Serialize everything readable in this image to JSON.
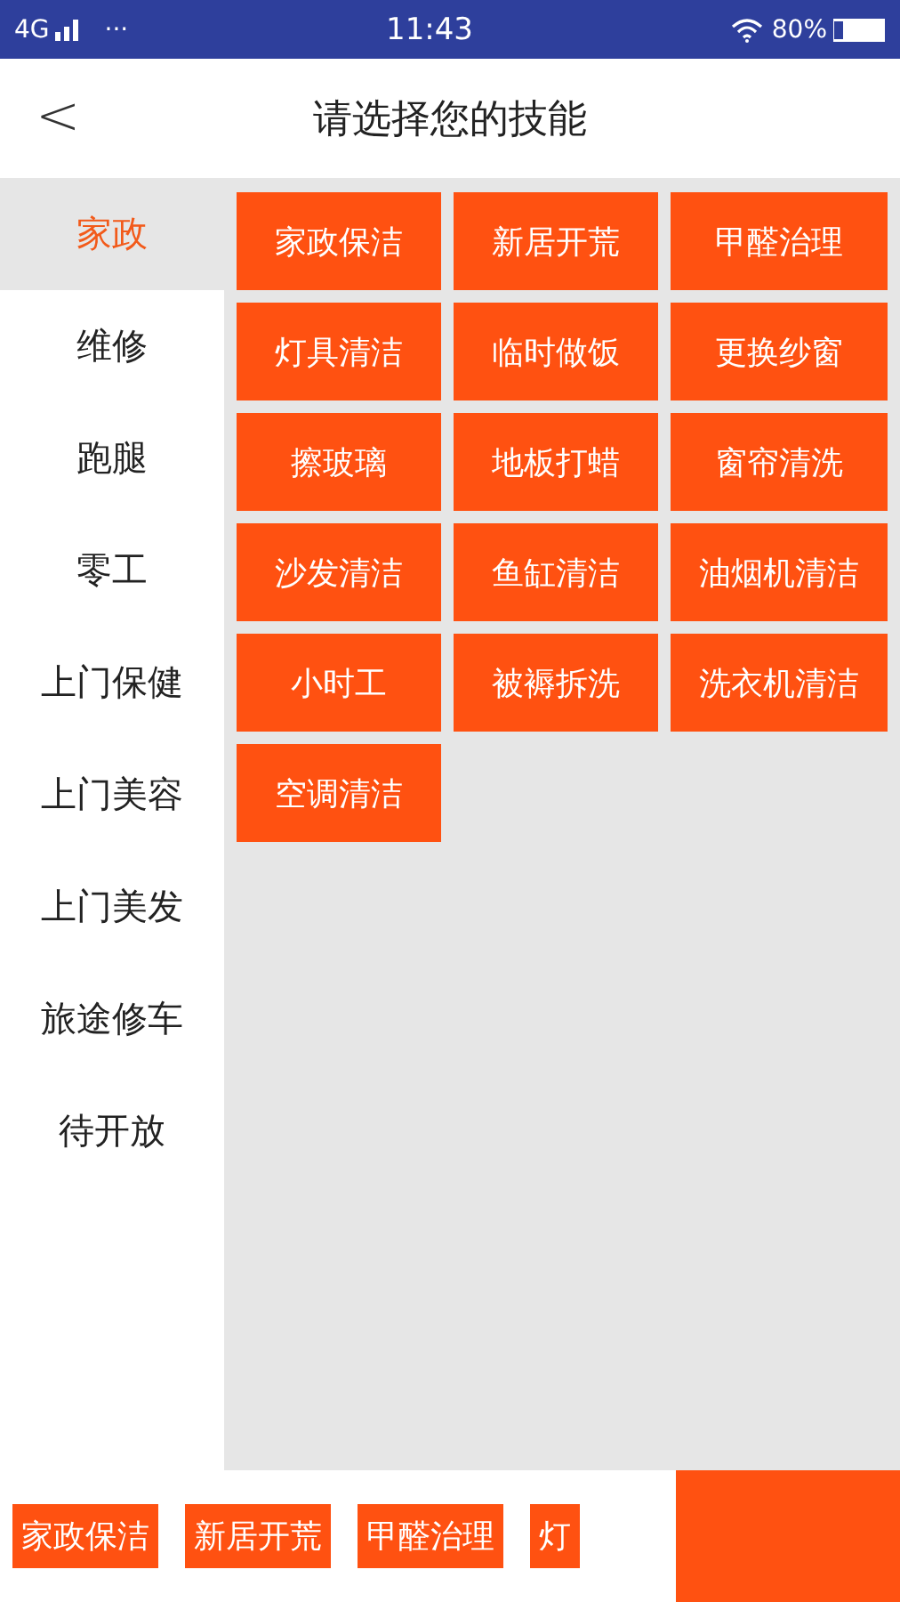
{
  "status_bar": {
    "network": "4G",
    "more": "···",
    "time": "11:43",
    "battery": "80%"
  },
  "header": {
    "back": "<",
    "title": "请选择您的技能"
  },
  "categories": [
    {
      "label": "家政",
      "selected": true
    },
    {
      "label": "维修",
      "selected": false
    },
    {
      "label": "跑腿",
      "selected": false
    },
    {
      "label": "零工",
      "selected": false
    },
    {
      "label": "上门保健",
      "selected": false
    },
    {
      "label": "上门美容",
      "selected": false
    },
    {
      "label": "上门美发",
      "selected": false
    },
    {
      "label": "旅途修车",
      "selected": false
    },
    {
      "label": "待开放",
      "selected": false
    }
  ],
  "skills": [
    "家政保洁",
    "新居开荒",
    "甲醛治理",
    "灯具清洁",
    "临时做饭",
    "更换纱窗",
    "擦玻璃",
    "地板打蜡",
    "窗帘清洗",
    "沙发清洁",
    "鱼缸清洁",
    "油烟机清洁",
    "小时工",
    "被褥拆洗",
    "洗衣机清洁",
    "空调清洁"
  ],
  "selected_skills": [
    "家政保洁",
    "新居开荒",
    "甲醛治理",
    "灯"
  ]
}
